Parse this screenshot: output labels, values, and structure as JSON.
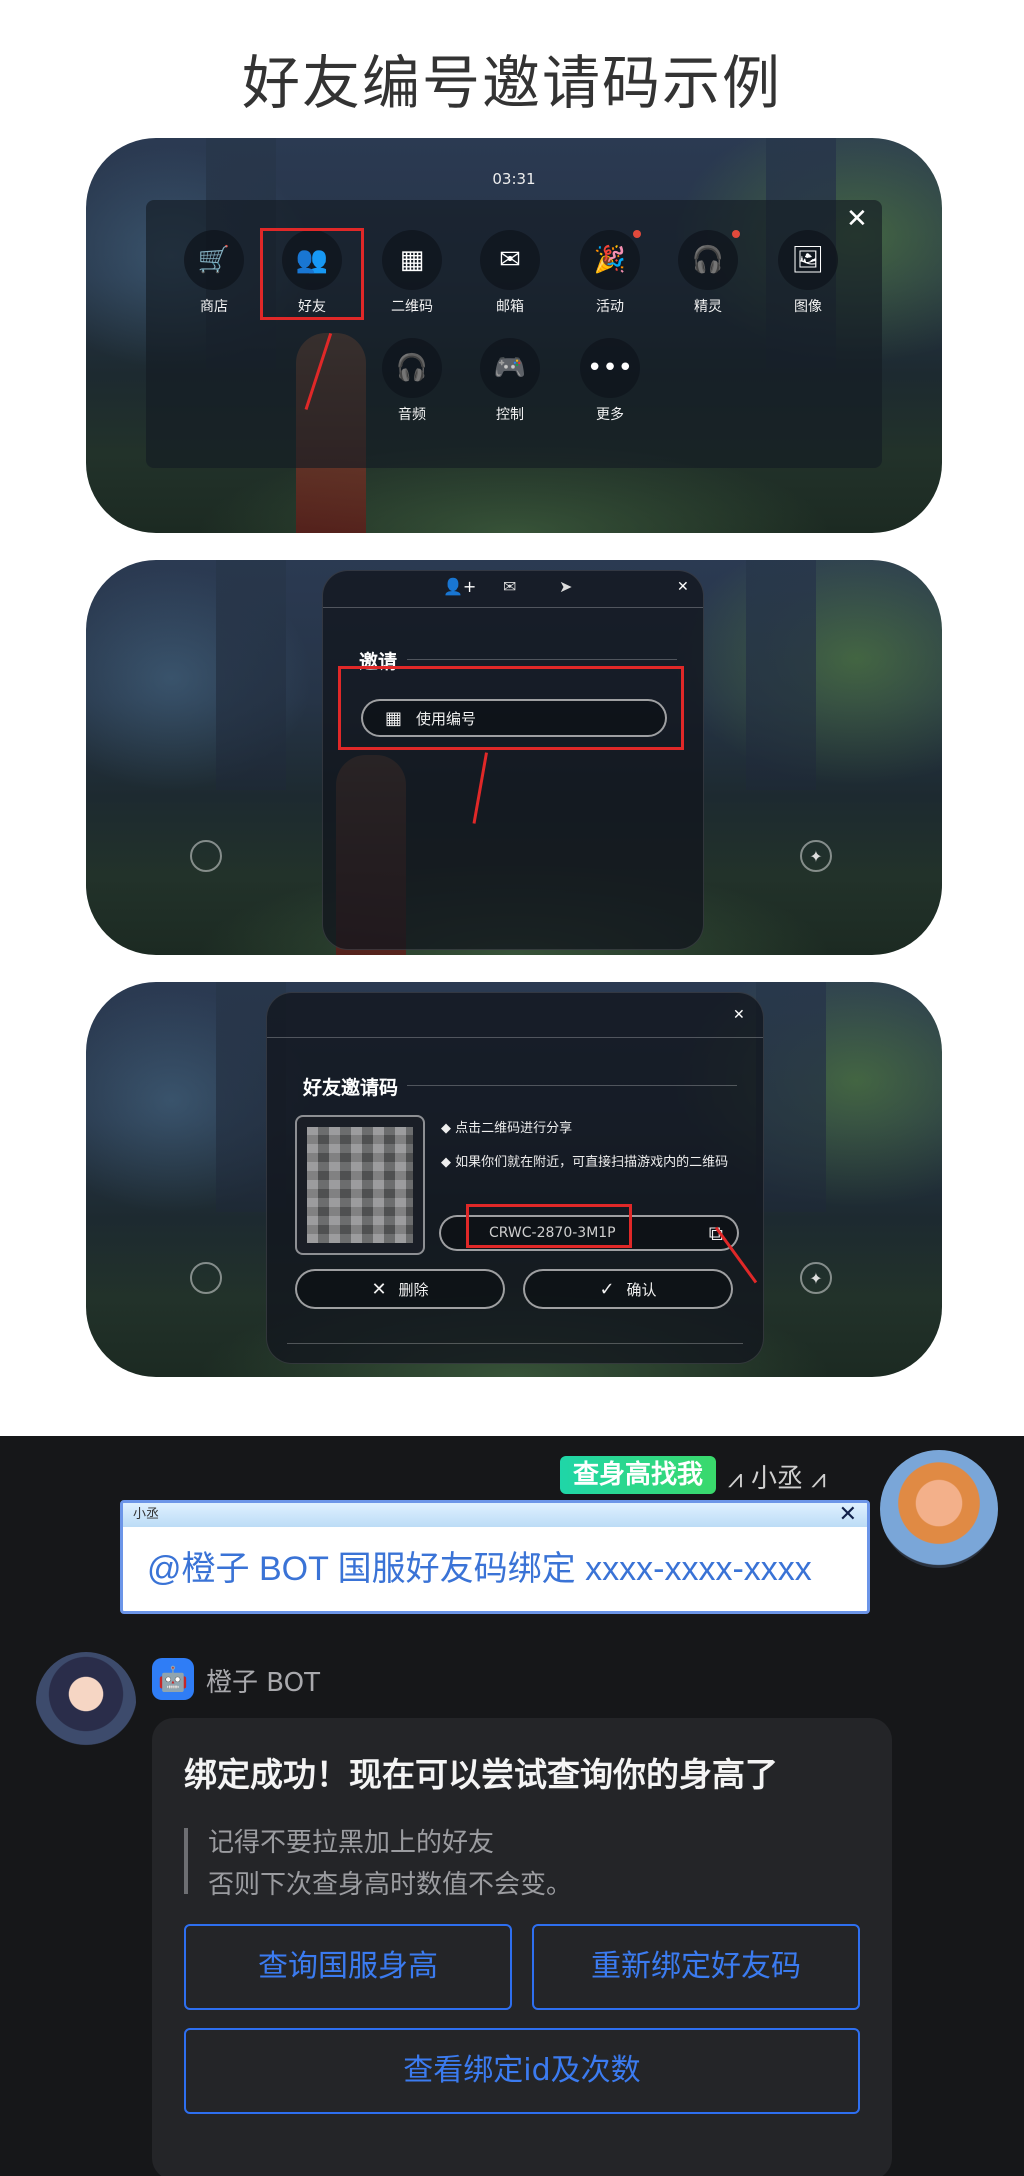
{
  "page_title": "好友编号邀请码示例",
  "panel1": {
    "time": "03:31",
    "close": "✕",
    "items": [
      {
        "label": "商店",
        "icon": "🛒"
      },
      {
        "label": "好友",
        "icon": "👥"
      },
      {
        "label": "二维码",
        "icon": "▦"
      },
      {
        "label": "邮箱",
        "icon": "✉"
      },
      {
        "label": "活动",
        "icon": "🎉"
      },
      {
        "label": "精灵",
        "icon": "🎧"
      },
      {
        "label": "图像",
        "icon": "🖼"
      },
      {
        "label": "音频",
        "icon": "🎧"
      },
      {
        "label": "控制",
        "icon": "🎮"
      },
      {
        "label": "更多",
        "icon": "•••"
      }
    ]
  },
  "panel2": {
    "tabs": [
      "👤+",
      "✉",
      "➤"
    ],
    "close": "✕",
    "section": "邀请",
    "button": "使用编号",
    "button_icon": "▦"
  },
  "panel3": {
    "close": "✕",
    "section": "好友邀请码",
    "tip1": "点击二维码进行分享",
    "tip2": "如果你们就在附近，可直接扫描游戏内的二维码",
    "code": "CRWC-2870-3M1P",
    "copy_icon": "⧉",
    "delete_label": "删除",
    "confirm_label": "确认",
    "delete_icon": "✕",
    "confirm_icon": "✓"
  },
  "chat": {
    "tag1": "查身高找我",
    "tag2": "小丞",
    "msg_header": "小丞",
    "msg_close": "✕",
    "message": "@橙子 BOT 国服好友码绑定 xxxx-xxxx-xxxx",
    "bot_name": "橙子 BOT",
    "bot_icon": "🤖",
    "card_title": "绑定成功！现在可以尝试查询你的身高了",
    "quote_line1": "记得不要拉黑加上的好友",
    "quote_line2": "否则下次查身高时数值不会变。",
    "btn1": "查询国服身高",
    "btn2": "重新绑定好友码",
    "btn3": "查看绑定id及次数"
  },
  "colors": {
    "accent_red": "#e02828",
    "bot_blue": "#2f7df6",
    "button_blue": "#3b7bf0",
    "chat_bg": "#161719"
  }
}
